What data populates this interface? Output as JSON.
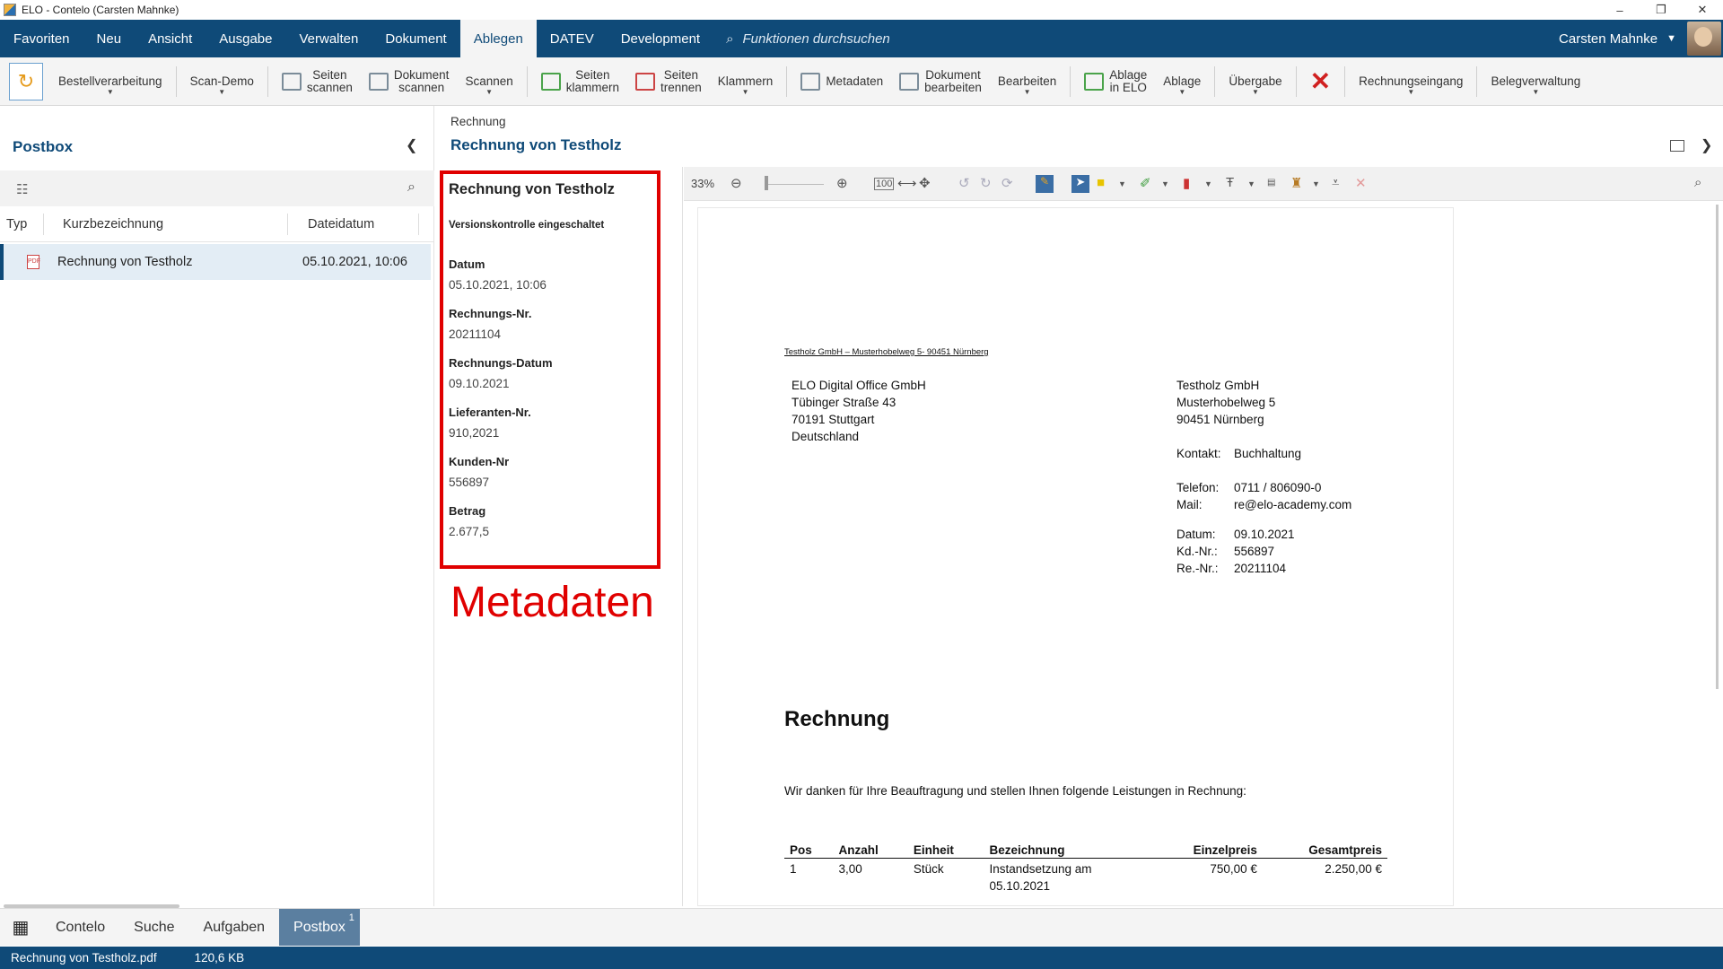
{
  "window": {
    "title": "ELO - Contelo (Carsten Mahnke)",
    "minimize": "–",
    "restore": "❐",
    "close": "✕"
  },
  "menu": {
    "items": [
      "Favoriten",
      "Neu",
      "Ansicht",
      "Ausgabe",
      "Verwalten",
      "Dokument",
      "Ablegen",
      "DATEV",
      "Development"
    ],
    "active": "Ablegen",
    "search_placeholder": "Funktionen durchsuchen",
    "user": "Carsten Mahnke"
  },
  "ribbon": {
    "buttons": [
      "Bestellverarbeitung",
      "Scan-Demo",
      "Seiten\nscannen",
      "Dokument\nscannen",
      "Scannen",
      "Seiten\nklammern",
      "Seiten\ntrennen",
      "Klammern",
      "Metadaten",
      "Dokument\nbearbeiten",
      "Bearbeiten",
      "Ablage\nin ELO",
      "Ablage",
      "Übergabe",
      "Rechnungseingang",
      "Belegverwaltung"
    ]
  },
  "postbox": {
    "title": "Postbox",
    "columns": [
      "Typ",
      "Kurzbezeichnung",
      "Dateidatum"
    ],
    "rows": [
      {
        "name": "Rechnung von Testholz",
        "date": "05.10.2021, 10:06"
      }
    ]
  },
  "document": {
    "breadcrumb": "Rechnung",
    "title": "Rechnung von Testholz"
  },
  "metadata": {
    "title": "Rechnung von Testholz",
    "version_control": "Versionskontrolle eingeschaltet",
    "fields": [
      {
        "label": "Datum",
        "value": "05.10.2021, 10:06"
      },
      {
        "label": "Rechnungs-Nr.",
        "value": "20211104"
      },
      {
        "label": "Rechnungs-Datum",
        "value": "09.10.2021"
      },
      {
        "label": "Lieferanten-Nr.",
        "value": "910,2021"
      },
      {
        "label": "Kunden-Nr",
        "value": "556897"
      },
      {
        "label": "Betrag",
        "value": "2.677,5"
      }
    ],
    "annotation": "Metadaten"
  },
  "viewer": {
    "zoom": "33%"
  },
  "invoice": {
    "sender_line": "Testholz GmbH – Musterhobelweg 5- 90451 Nürnberg",
    "recipient": [
      "ELO Digital Office GmbH",
      "Tübinger Straße 43",
      "70191 Stuttgart",
      "Deutschland"
    ],
    "vendor": {
      "name": "Testholz GmbH",
      "street": "Musterhobelweg 5",
      "city": "90451 Nürnberg",
      "contact_label": "Kontakt:",
      "contact": "Buchhaltung",
      "phone_label": "Telefon:",
      "phone": "0711 / 806090-0",
      "mail_label": "Mail:",
      "mail": "re@elo-academy.com",
      "date_label": "Datum:",
      "date": "09.10.2021",
      "kd_label": "Kd.-Nr.:",
      "kd": "556897",
      "re_label": "Re.-Nr.:",
      "re": "20211104"
    },
    "heading": "Rechnung",
    "intro": "Wir danken für Ihre Beauftragung und stellen Ihnen folgende Leistungen in Rechnung:",
    "table": {
      "headers": [
        "Pos",
        "Anzahl",
        "Einheit",
        "Bezeichnung",
        "Einzelpreis",
        "Gesamtpreis"
      ],
      "rows": [
        [
          "1",
          "3,00",
          "Stück",
          "Instandsetzung am\n05.10.2021",
          "750,00 €",
          "2.250,00 €"
        ]
      ]
    }
  },
  "bottom_tabs": {
    "items": [
      "Contelo",
      "Suche",
      "Aufgaben",
      "Postbox"
    ],
    "active": "Postbox",
    "badge": "1"
  },
  "status": {
    "file": "Rechnung von Testholz.pdf",
    "size": "120,6 KB"
  },
  "colors": {
    "brand_blue": "#0f4a78",
    "highlight_red": "#e00000"
  }
}
